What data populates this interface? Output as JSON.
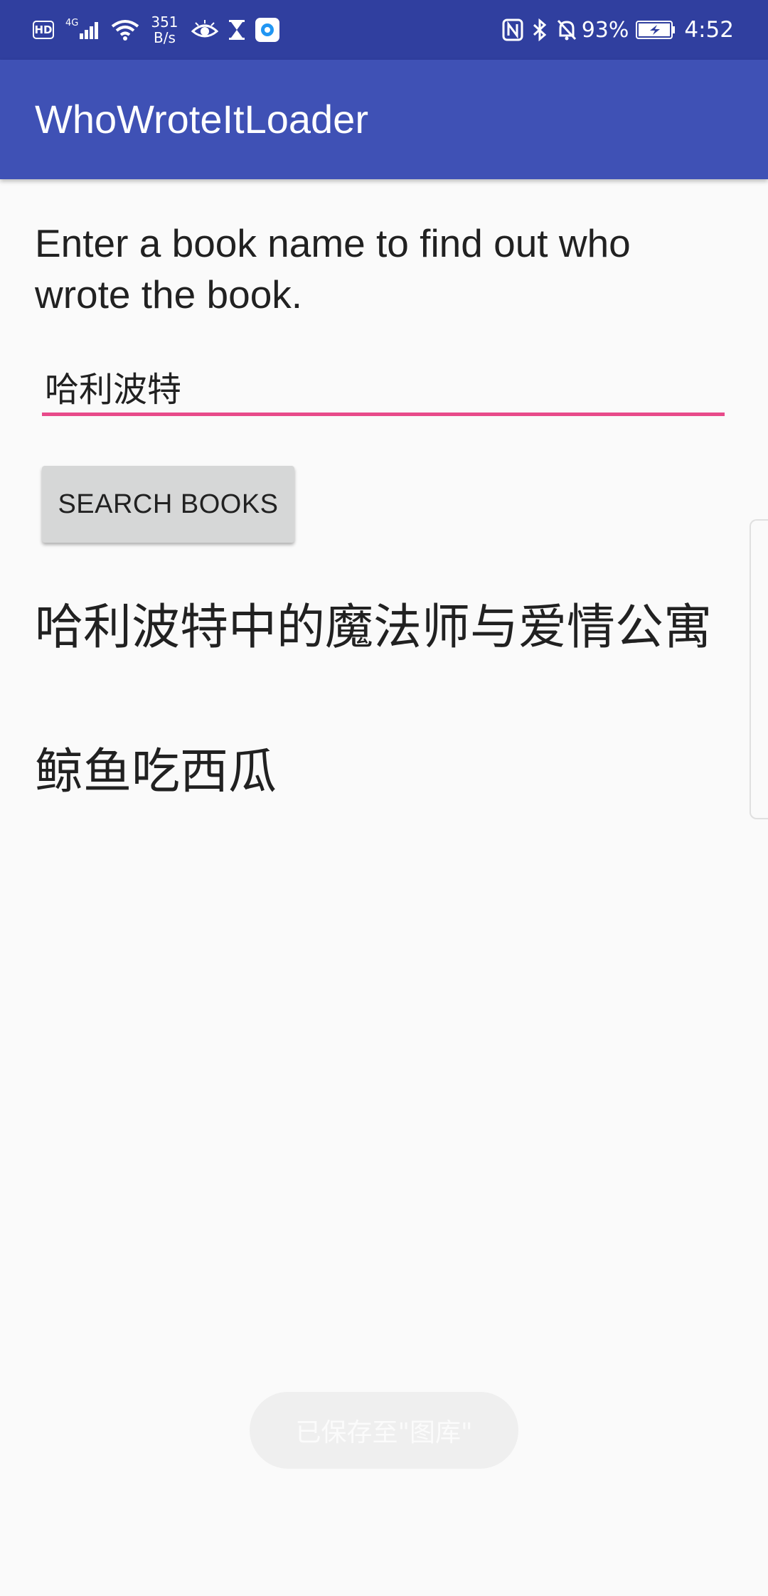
{
  "status_bar": {
    "hd_label": "HD",
    "network_type": "4G",
    "speed_value": "351",
    "speed_unit": "B/s",
    "battery_percent": "93%",
    "time": "4:52",
    "icons": [
      "hd-badge",
      "4g-signal-icon",
      "wifi-icon",
      "eye-icon",
      "hourglass-icon",
      "app-notification-icon",
      "nfc-icon",
      "bluetooth-icon",
      "mute-icon",
      "battery-charging-icon"
    ]
  },
  "app_bar": {
    "title": "WhoWroteItLoader",
    "color": "#3f51b5"
  },
  "main": {
    "instructions": "Enter a book name to find out who wrote the book.",
    "book_input": {
      "value": "哈利波特",
      "underline_color": "#e84a8a"
    },
    "search_button_label": "SEARCH BOOKS",
    "result_title": "哈利波特中的魔法师与爱情公寓",
    "result_author": "鲸鱼吃西瓜"
  },
  "toast": {
    "text": "已保存至\"图库\""
  }
}
